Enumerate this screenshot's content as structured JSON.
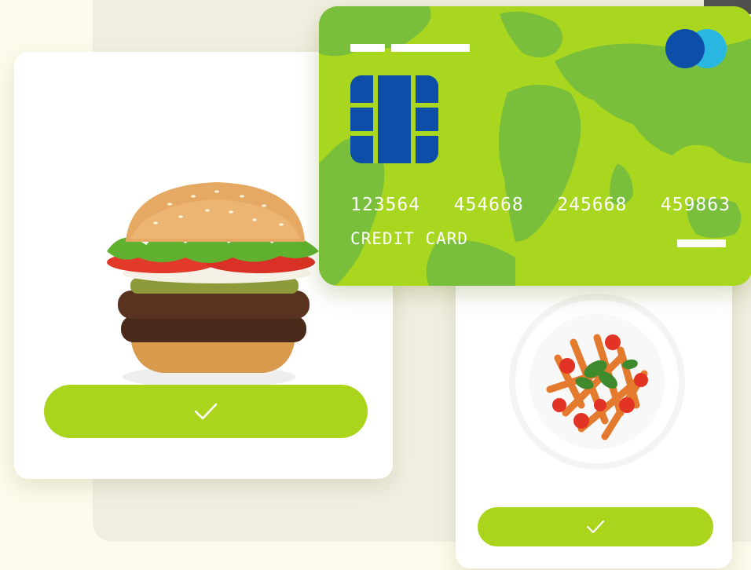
{
  "credit_card": {
    "number_groups": [
      "123564",
      "454668",
      "245668",
      "459863"
    ],
    "label": "CREDIT CARD",
    "chip_icon": "card-chip-icon",
    "brand_icon": "card-brand-circles-icon"
  },
  "orders": [
    {
      "item_icon": "burger-image",
      "confirm_icon": "checkmark-icon"
    },
    {
      "item_icon": "pasta-plate-image",
      "confirm_icon": "checkmark-icon"
    }
  ],
  "colors": {
    "accent_green": "#abd41d",
    "card_green": "#a9d61f",
    "map_green": "#79bf3b",
    "chip_blue": "#0c4ea8",
    "brand_light_blue": "#29b7e2",
    "page_background": "#fdfbeb",
    "backdrop": "#f2efe1"
  }
}
